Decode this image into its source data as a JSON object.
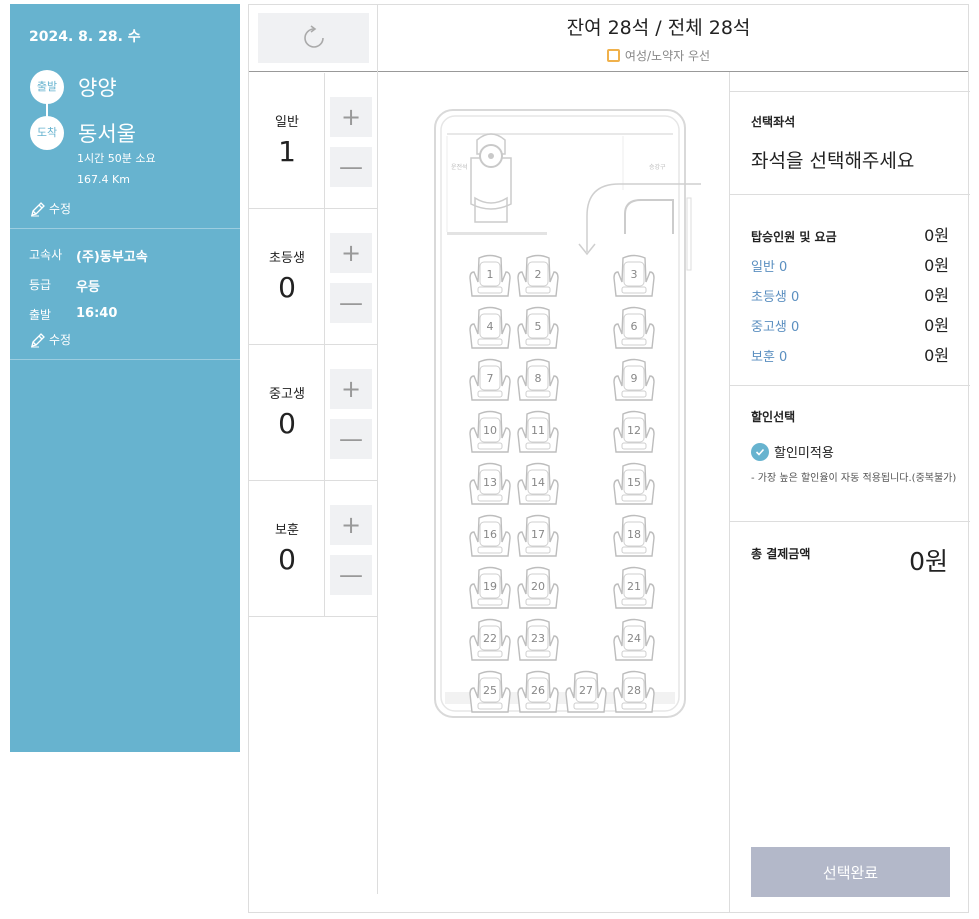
{
  "trip": {
    "date": "2024. 8. 28. 수",
    "departure_badge": "출발",
    "arrival_badge": "도착",
    "departure": "양양",
    "arrival": "동서울",
    "duration": "1시간 50분 소요",
    "distance": "167.4 Km",
    "edit_label": "수정",
    "company_label": "고속사",
    "company": "(주)동부고속",
    "grade_label": "등급",
    "grade": "우등",
    "depart_label": "출발",
    "depart_time": "16:40"
  },
  "header": {
    "seat_summary": "잔여 28석 / 전체 28석",
    "priority_legend": "여성/노약자 우선"
  },
  "passengers": [
    {
      "label": "일반",
      "count": "1"
    },
    {
      "label": "초등생",
      "count": "0"
    },
    {
      "label": "중고생",
      "count": "0"
    },
    {
      "label": "보훈",
      "count": "0"
    }
  ],
  "controls": {
    "plus": "+",
    "minus": "—"
  },
  "bus": {
    "driver_label": "운전석",
    "door_label": "승강구",
    "seats": [
      "1",
      "2",
      "3",
      "4",
      "5",
      "6",
      "7",
      "8",
      "9",
      "10",
      "11",
      "12",
      "13",
      "14",
      "15",
      "16",
      "17",
      "18",
      "19",
      "20",
      "21",
      "22",
      "23",
      "24",
      "25",
      "26",
      "27",
      "28"
    ]
  },
  "summary": {
    "selected_title": "선택좌석",
    "selected_msg": "좌석을 선택해주세요",
    "fare_title": "탑승인원 및 요금",
    "fare_total": "0원",
    "fare_rows": [
      {
        "label": "일반 0",
        "value": "0원"
      },
      {
        "label": "초등생 0",
        "value": "0원"
      },
      {
        "label": "중고생 0",
        "value": "0원"
      },
      {
        "label": "보훈 0",
        "value": "0원"
      }
    ],
    "discount_title": "할인선택",
    "discount_option": "할인미적용",
    "discount_note": "- 가장 높은 할인율이 자동 적용됩니다.(중복불가)",
    "total_title": "총 결제금액",
    "total_amount": "0원",
    "complete_label": "선택완료"
  },
  "colors": {
    "accent": "#67b3cf",
    "priority": "#f0b14b",
    "button_disabled": "#b3b8c9"
  }
}
